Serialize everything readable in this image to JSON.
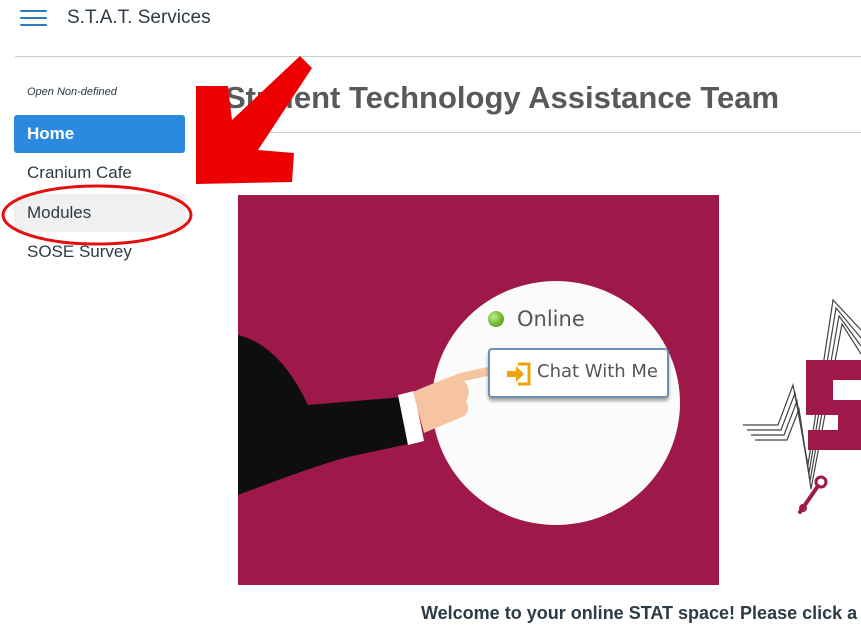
{
  "header": {
    "breadcrumb": "S.T.A.T. Services"
  },
  "nav": {
    "title": "Open Non-defined",
    "items": [
      {
        "label": "Home"
      },
      {
        "label": "Cranium Cafe"
      },
      {
        "label": "Modules"
      },
      {
        "label": "SOSE Survey"
      }
    ]
  },
  "main": {
    "title": "Student Technology Assistance Team",
    "banner": {
      "status": "Online",
      "chat_button": "Chat With Me"
    },
    "welcome": "Welcome to your online STAT space! Please click a"
  },
  "icons": [
    "hamburger-icon",
    "status-dot-icon",
    "enter-icon",
    "wrench-icon"
  ],
  "colors": {
    "accent": "#2b8ae0",
    "banner": "#9e1849",
    "annotation": "#ee0000"
  }
}
